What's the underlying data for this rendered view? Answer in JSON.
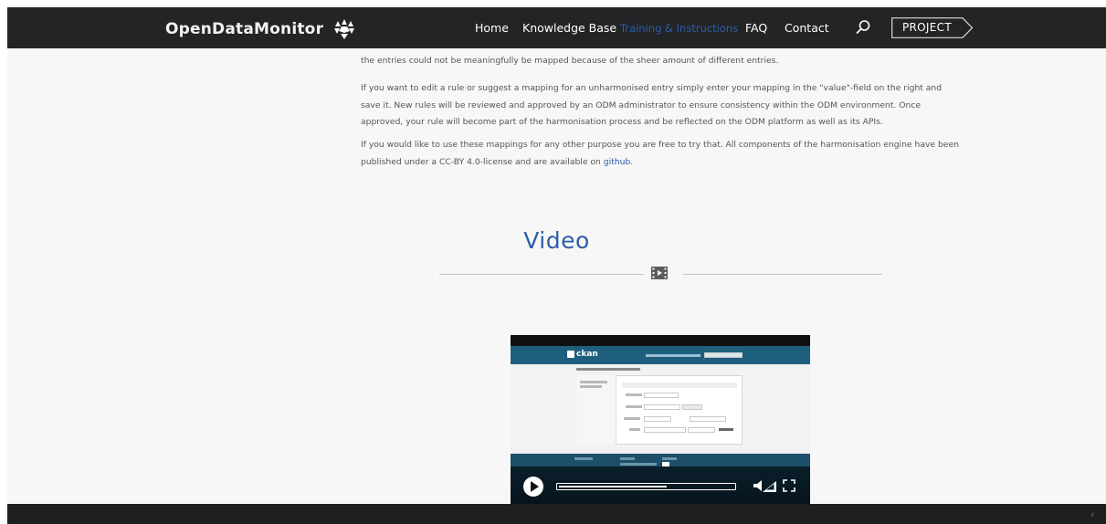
{
  "header": {
    "logo_text": "OpenDataMonitor",
    "nav": [
      {
        "label": "Home",
        "active": false
      },
      {
        "label": "Knowledge Base",
        "active": false
      },
      {
        "label": "Training & Instructions",
        "active": true
      },
      {
        "label": "FAQ",
        "active": false
      },
      {
        "label": "Contact",
        "active": false
      }
    ],
    "project_label": "PROJECT",
    "search_icon": "search-icon"
  },
  "content": {
    "paragraph_1": "the entries could not be meaningfully be mapped because of the sheer amount of different entries.",
    "paragraph_2": "If you want to edit a rule or suggest a mapping for an unharmonised entry simply enter your mapping in the \"value\"-field on the right and save it. New rules will be reviewed and approved by an ODM administrator to ensure consistency within the ODM environment. Once approved, your rule will become part of the harmonisation process and be reflected on the ODM platform as well as its APIs.",
    "paragraph_3_prefix": "If you would like to use these mappings for any other purpose you are free to try that. All components of the harmonisation engine have been published under a CC-BY 4.0-license and are available on ",
    "paragraph_3_link": "github",
    "paragraph_3_suffix": "."
  },
  "video": {
    "section_title": "Video",
    "section_icon": "film-icon",
    "player_logo": "ckan",
    "progress": 0.62
  },
  "colors": {
    "accent": "#2b5da9",
    "header_bg": "#222426",
    "page_bg": "#f7f7f7",
    "text": "#555555"
  }
}
